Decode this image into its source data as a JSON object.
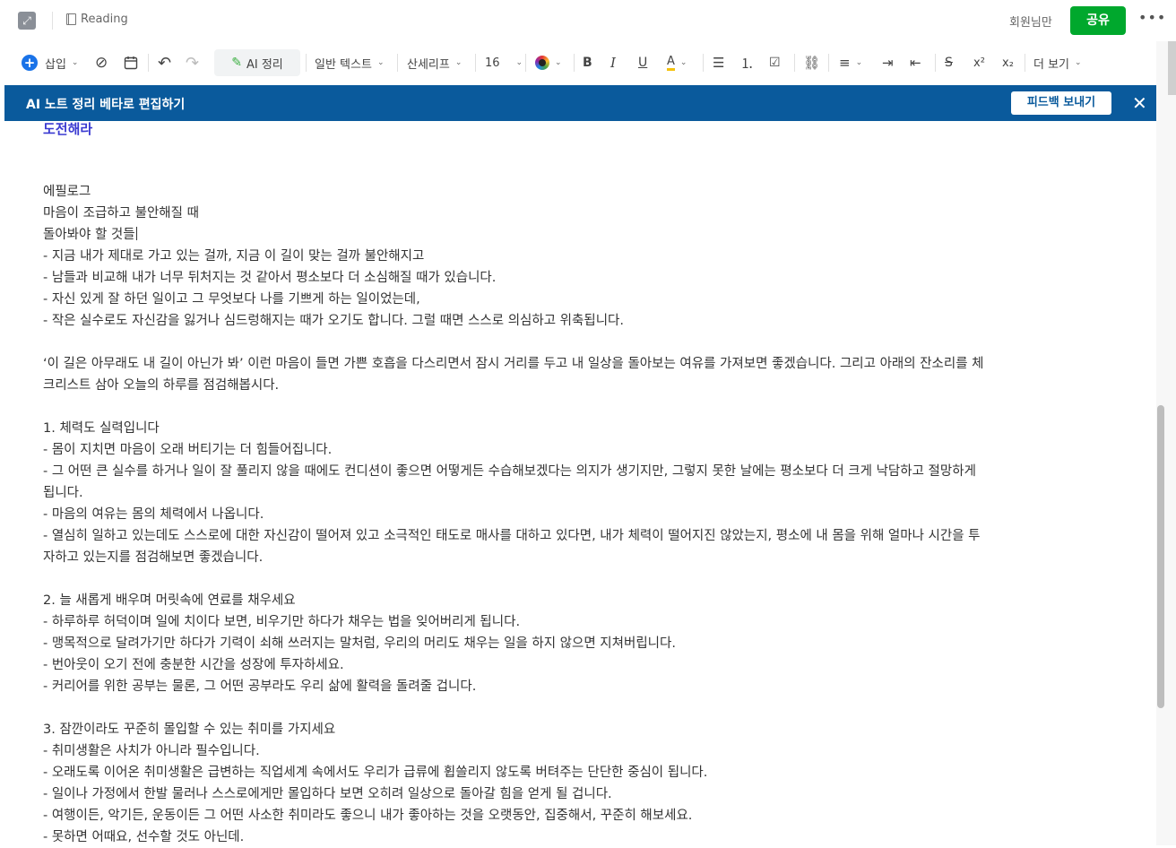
{
  "topbar": {
    "notebook": "Reading",
    "user": "회원님만",
    "share": "공유",
    "more": "•••"
  },
  "toolbar": {
    "insert": "삽입",
    "ai": "AI 정리",
    "style": "일반 텍스트",
    "font": "산세리프",
    "size": "16",
    "more": "더 보기"
  },
  "banner": {
    "title": "AI 노트 정리 베타로 편집하기",
    "feedback": "피드백 보내기"
  },
  "note": {
    "heading": "도전해라",
    "lines": [
      "에필로그",
      "마음이 조급하고 불안해질 때",
      "돌아봐야 할 것들",
      "- 지금 내가 제대로 가고 있는 걸까, 지금 이 길이 맞는 걸까 불안해지고",
      "- 남들과 비교해 내가 너무 뒤처지는 것 같아서 평소보다 더 소심해질 때가 있습니다.",
      "- 자신 있게 잘 하던 일이고 그 무엇보다 나를 기쁘게 하는 일이었는데,",
      "- 작은 실수로도 자신감을 잃거나 심드렁해지는 때가 오기도 합니다. 그럴 때면 스스로 의심하고 위축됩니다.",
      "",
      "‘이 길은 아무래도 내 길이 아닌가 봐’ 이런 마음이 들면 가쁜 호흡을 다스리면서 잠시 거리를 두고 내 일상을 돌아보는 여유를 가져보면 좋겠습니다. 그리고 아래의 잔소리를 체",
      "크리스트 삼아 오늘의 하루를 점검해봅시다.",
      "",
      "1. 체력도 실력입니다",
      "- 몸이 지치면 마음이 오래 버티기는 더 힘들어집니다.",
      "- 그 어떤 큰 실수를 하거나 일이 잘 풀리지 않을 때에도 컨디션이 좋으면 어떻게든 수습해보겠다는 의지가 생기지만, 그렇지 못한 날에는 평소보다 더 크게 낙담하고 절망하게",
      "됩니다.",
      "- 마음의 여유는 몸의 체력에서 나옵니다.",
      "- 열심히 일하고 있는데도 스스로에 대한 자신감이 떨어져 있고 소극적인 태도로 매사를 대하고 있다면, 내가 체력이 떨어지진 않았는지, 평소에 내 몸을 위해 얼마나 시간을 투",
      "자하고 있는지를 점검해보면 좋겠습니다.",
      "",
      "2. 늘 새롭게 배우며 머릿속에 연료를 채우세요",
      "- 하루하루 허덕이며 일에 치이다 보면, 비우기만 하다가 채우는 법을 잊어버리게 됩니다.",
      "- 맹목적으로 달려가기만 하다가 기력이 쇠해 쓰러지는 말처럼, 우리의 머리도 채우는 일을 하지 않으면 지쳐버립니다.",
      "- 번아웃이 오기 전에 충분한 시간을 성장에 투자하세요.",
      "- 커리어를 위한 공부는 물론, 그 어떤 공부라도 우리 삶에 활력을 돌려줄 겁니다.",
      "",
      "3. 잠깐이라도 꾸준히 몰입할 수 있는 취미를 가지세요",
      "- 취미생활은 사치가 아니라 필수입니다.",
      "- 오래도록 이어온 취미생활은 급변하는 직업세계 속에서도 우리가 급류에 휩쓸리지 않도록 버텨주는 단단한 중심이 됩니다.",
      "- 일이나 가정에서 한발 물러나 스스로에게만 몰입하다 보면 오히려 일상으로 돌아갈 힘을 얻게 될 겁니다.",
      "- 여행이든, 악기든, 운동이든 그 어떤 사소한 취미라도 좋으니 내가 좋아하는 것을 오랫동안, 집중해서, 꾸준히 해보세요.",
      "- 못하면 어때요, 선수할 것도 아닌데."
    ]
  }
}
